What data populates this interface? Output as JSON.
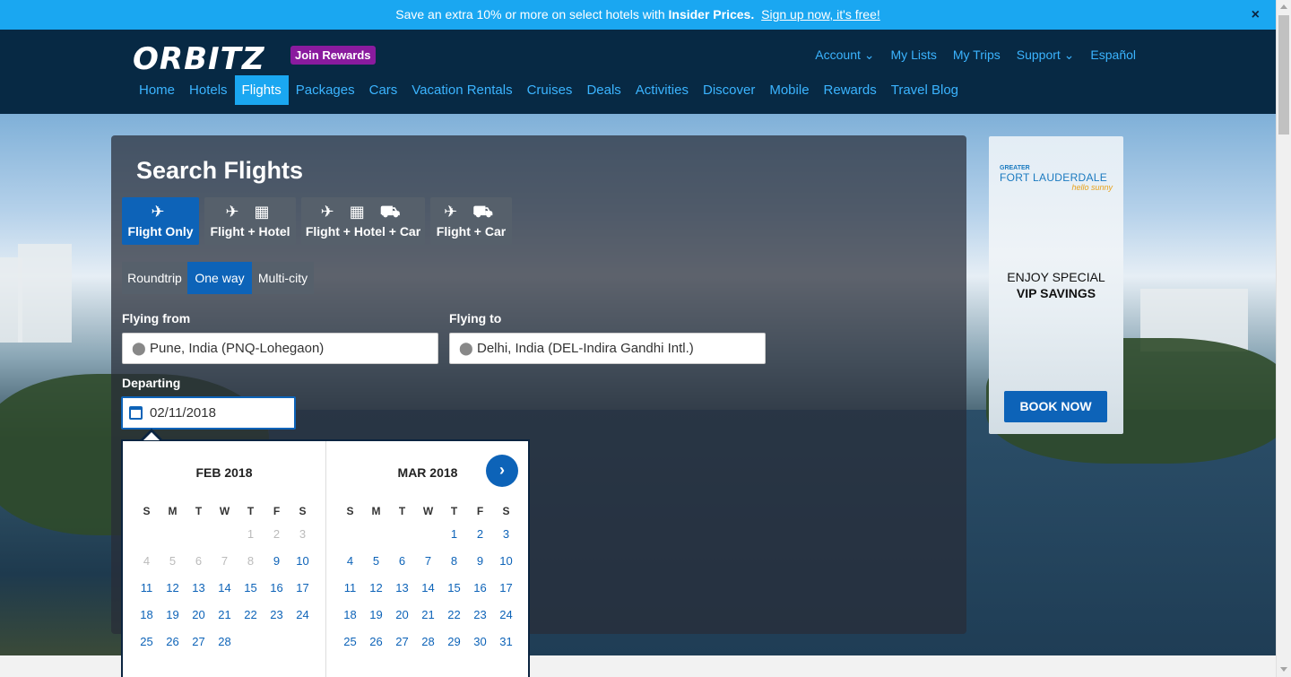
{
  "promo": {
    "text": "Save an extra 10% or more on select hotels with",
    "bold": "Insider Prices.",
    "link": "Sign up now, it's free!",
    "close": "×"
  },
  "header": {
    "logo": "ORBITZ",
    "join_rewards": "Join Rewards",
    "util": [
      "Account ⌄",
      "My Lists",
      "My Trips",
      "Support ⌄",
      "Español"
    ],
    "nav": [
      "Home",
      "Hotels",
      "Flights",
      "Packages",
      "Cars",
      "Vacation Rentals",
      "Cruises",
      "Deals",
      "Activities",
      "Discover",
      "Mobile",
      "Rewards",
      "Travel Blog"
    ],
    "active_nav": "Flights"
  },
  "search": {
    "title": "Search Flights",
    "package_types": [
      {
        "label": "Flight Only",
        "icons": "✈"
      },
      {
        "label": "Flight + Hotel",
        "icons": "✈ ▦"
      },
      {
        "label": "Flight + Hotel + Car",
        "icons": "✈ ▦ ⛟"
      },
      {
        "label": "Flight + Car",
        "icons": "✈ ⛟"
      }
    ],
    "trip_types": [
      "Roundtrip",
      "One way",
      "Multi-city"
    ],
    "active_trip": "One way",
    "flying_from_label": "Flying from",
    "flying_from_value": "Pune, India (PNQ-Lohegaon)",
    "flying_to_label": "Flying to",
    "flying_to_value": "Delhi, India (DEL-Indira Gandhi Intl.)",
    "departing_label": "Departing",
    "departing_value": "02/11/2018"
  },
  "calendar": {
    "dow": [
      "S",
      "M",
      "T",
      "W",
      "T",
      "F",
      "S"
    ],
    "months": [
      {
        "title": "FEB 2018",
        "days": [
          "",
          "",
          "",
          "",
          "1",
          "2",
          "3",
          "4",
          "5",
          "6",
          "7",
          "8",
          "9",
          "10",
          "11",
          "12",
          "13",
          "14",
          "15",
          "16",
          "17",
          "18",
          "19",
          "20",
          "21",
          "22",
          "23",
          "24",
          "25",
          "26",
          "27",
          "28"
        ],
        "disabled": [
          "1",
          "2",
          "3",
          "4",
          "5",
          "6",
          "7",
          "8"
        ]
      },
      {
        "title": "MAR 2018",
        "days": [
          "",
          "",
          "",
          "",
          "1",
          "2",
          "3",
          "4",
          "5",
          "6",
          "7",
          "8",
          "9",
          "10",
          "11",
          "12",
          "13",
          "14",
          "15",
          "16",
          "17",
          "18",
          "19",
          "20",
          "21",
          "22",
          "23",
          "24",
          "25",
          "26",
          "27",
          "28",
          "29",
          "30",
          "31"
        ],
        "disabled": []
      }
    ],
    "next_icon": "›"
  },
  "ad": {
    "greater": "GREATER",
    "brand": "FORT LAUDERDALE",
    "tagline": "hello sunny",
    "enjoy": "ENJOY SPECIAL",
    "vip": "VIP SAVINGS",
    "cta": "BOOK NOW"
  }
}
